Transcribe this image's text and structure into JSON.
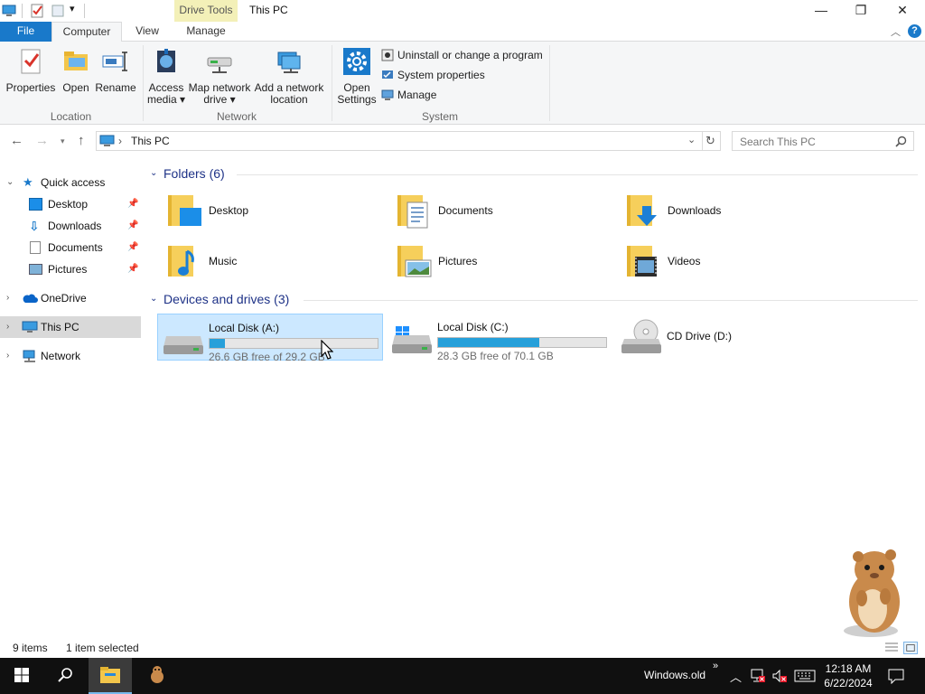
{
  "window": {
    "title": "This PC",
    "context_tab": "Drive Tools",
    "controls": {
      "minimize": "—",
      "restore": "❐",
      "close": "✕"
    }
  },
  "ribbon_tabs": [
    "File",
    "Computer",
    "View",
    "Manage"
  ],
  "ribbon": {
    "location": {
      "label": "Location",
      "buttons": [
        "Properties",
        "Open",
        "Rename"
      ]
    },
    "network": {
      "label": "Network",
      "access_media": [
        "Access",
        "media ▾"
      ],
      "map_drive": [
        "Map network",
        "drive ▾"
      ],
      "add_location": [
        "Add a network",
        "location"
      ]
    },
    "system": {
      "label": "System",
      "open_settings": [
        "Open",
        "Settings"
      ],
      "uninstall": "Uninstall or change a program",
      "system_properties": "System properties",
      "manage": "Manage"
    }
  },
  "address": {
    "path": "This PC",
    "separator": "›",
    "search_placeholder": "Search This PC"
  },
  "nav": {
    "quick_access": "Quick access",
    "desktop": "Desktop",
    "downloads": "Downloads",
    "documents": "Documents",
    "pictures": "Pictures",
    "onedrive": "OneDrive",
    "this_pc": "This PC",
    "network": "Network"
  },
  "folders_section": {
    "title": "Folders (6)",
    "items": [
      "Desktop",
      "Documents",
      "Downloads",
      "Music",
      "Pictures",
      "Videos"
    ]
  },
  "drives_section": {
    "title": "Devices and drives (3)",
    "drives": [
      {
        "name": "Local Disk (A:)",
        "free": "26.6 GB free of 29.2 GB",
        "used_fraction": 0.09
      },
      {
        "name": "Local Disk (C:)",
        "free": "28.3 GB free of 70.1 GB",
        "used_fraction": 0.6
      },
      {
        "name": "CD Drive (D:)"
      }
    ]
  },
  "status": {
    "items": "9 items",
    "selected": "1 item selected"
  },
  "taskbar": {
    "toolbar_label": "Windows.old",
    "time": "12:18 AM",
    "date": "6/22/2024"
  },
  "colors": {
    "accent": "#1979ca",
    "selection": "#cce8ff",
    "bar_fill": "#26a0da",
    "section_title": "#1e3287"
  }
}
